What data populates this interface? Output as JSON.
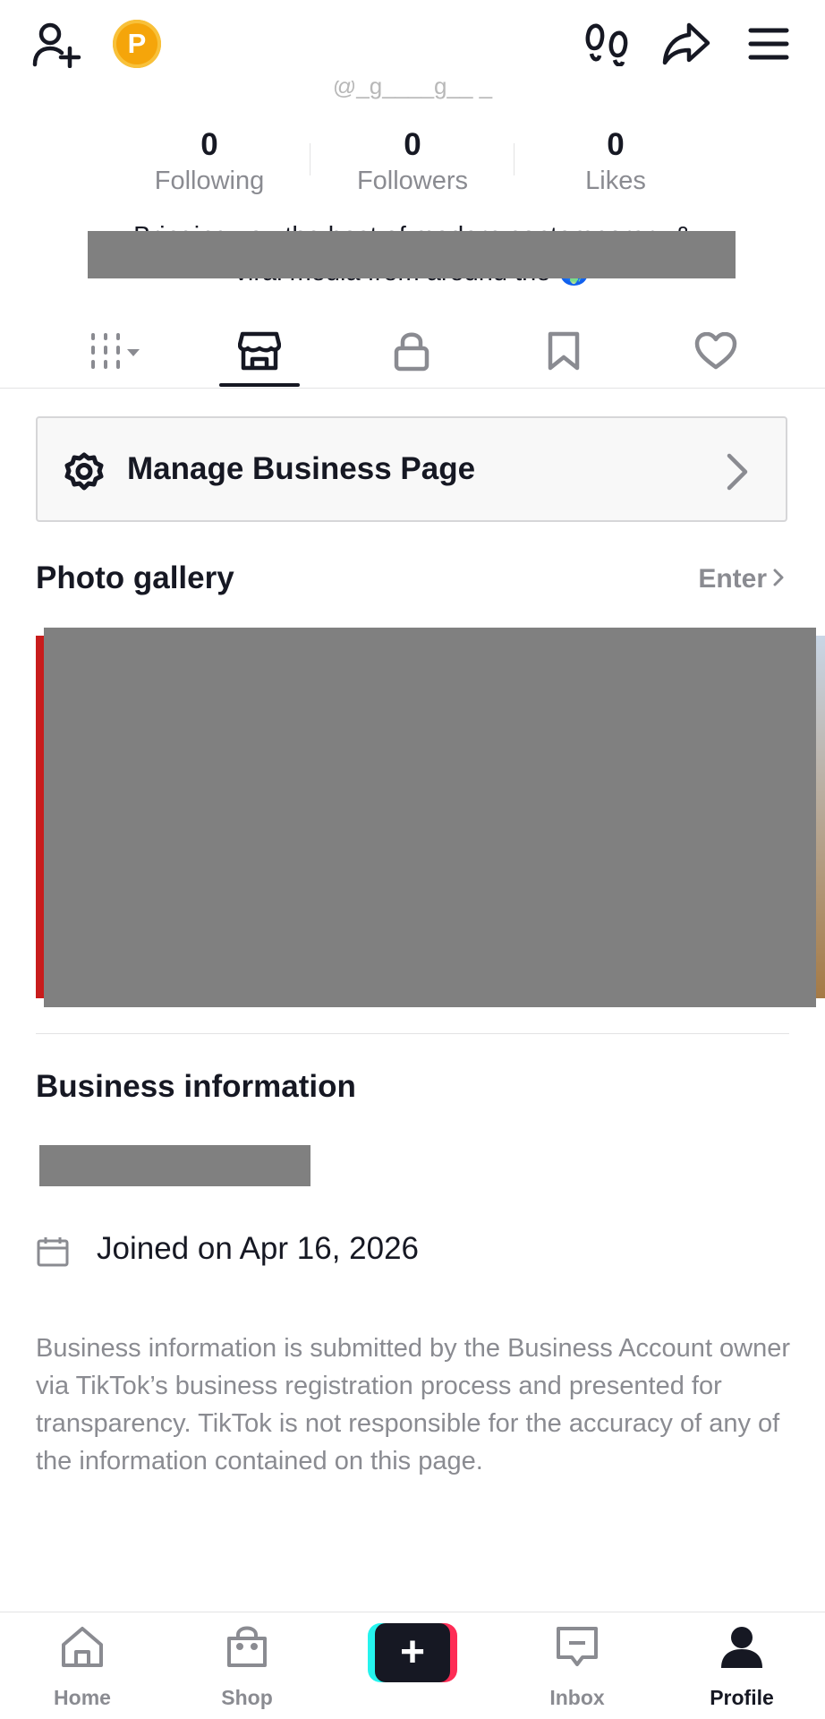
{
  "header": {
    "coin_letter": "P",
    "username_partial": "@_g____g__ _"
  },
  "stats": [
    {
      "value": "0",
      "label": "Following"
    },
    {
      "value": "0",
      "label": "Followers"
    },
    {
      "value": "0",
      "label": "Likes"
    }
  ],
  "bio": {
    "line1": "Bringing you the best of modern contemporary &",
    "line2": "viral media from around the 🌍"
  },
  "tabs": [
    {
      "icon": "grid-dropdown-icon",
      "active": false
    },
    {
      "icon": "shop-icon",
      "active": true
    },
    {
      "icon": "lock-icon",
      "active": false
    },
    {
      "icon": "bookmark-icon",
      "active": false
    },
    {
      "icon": "heart-icon",
      "active": false
    }
  ],
  "manage_business": {
    "label": "Manage Business Page",
    "icon": "gear-icon"
  },
  "photo_gallery": {
    "title": "Photo gallery",
    "enter_label": "Enter"
  },
  "business_info": {
    "title": "Business information",
    "joined": "Joined on Apr 16, 2026",
    "disclaimer": "Business information is submitted by the Business Account owner via TikTok’s business registration process and presented for transparency. TikTok is not responsible for the accuracy of any of the information contained on this page."
  },
  "bottom_nav": {
    "home": "Home",
    "shop": "Shop",
    "create": "+",
    "inbox": "Inbox",
    "profile": "Profile"
  },
  "colors": {
    "text": "#161823",
    "muted": "#8a8b91",
    "coin": "#f5a50a",
    "create_cyan": "#25f4ee",
    "create_pink": "#fe2c55",
    "redaction": "#808080"
  }
}
